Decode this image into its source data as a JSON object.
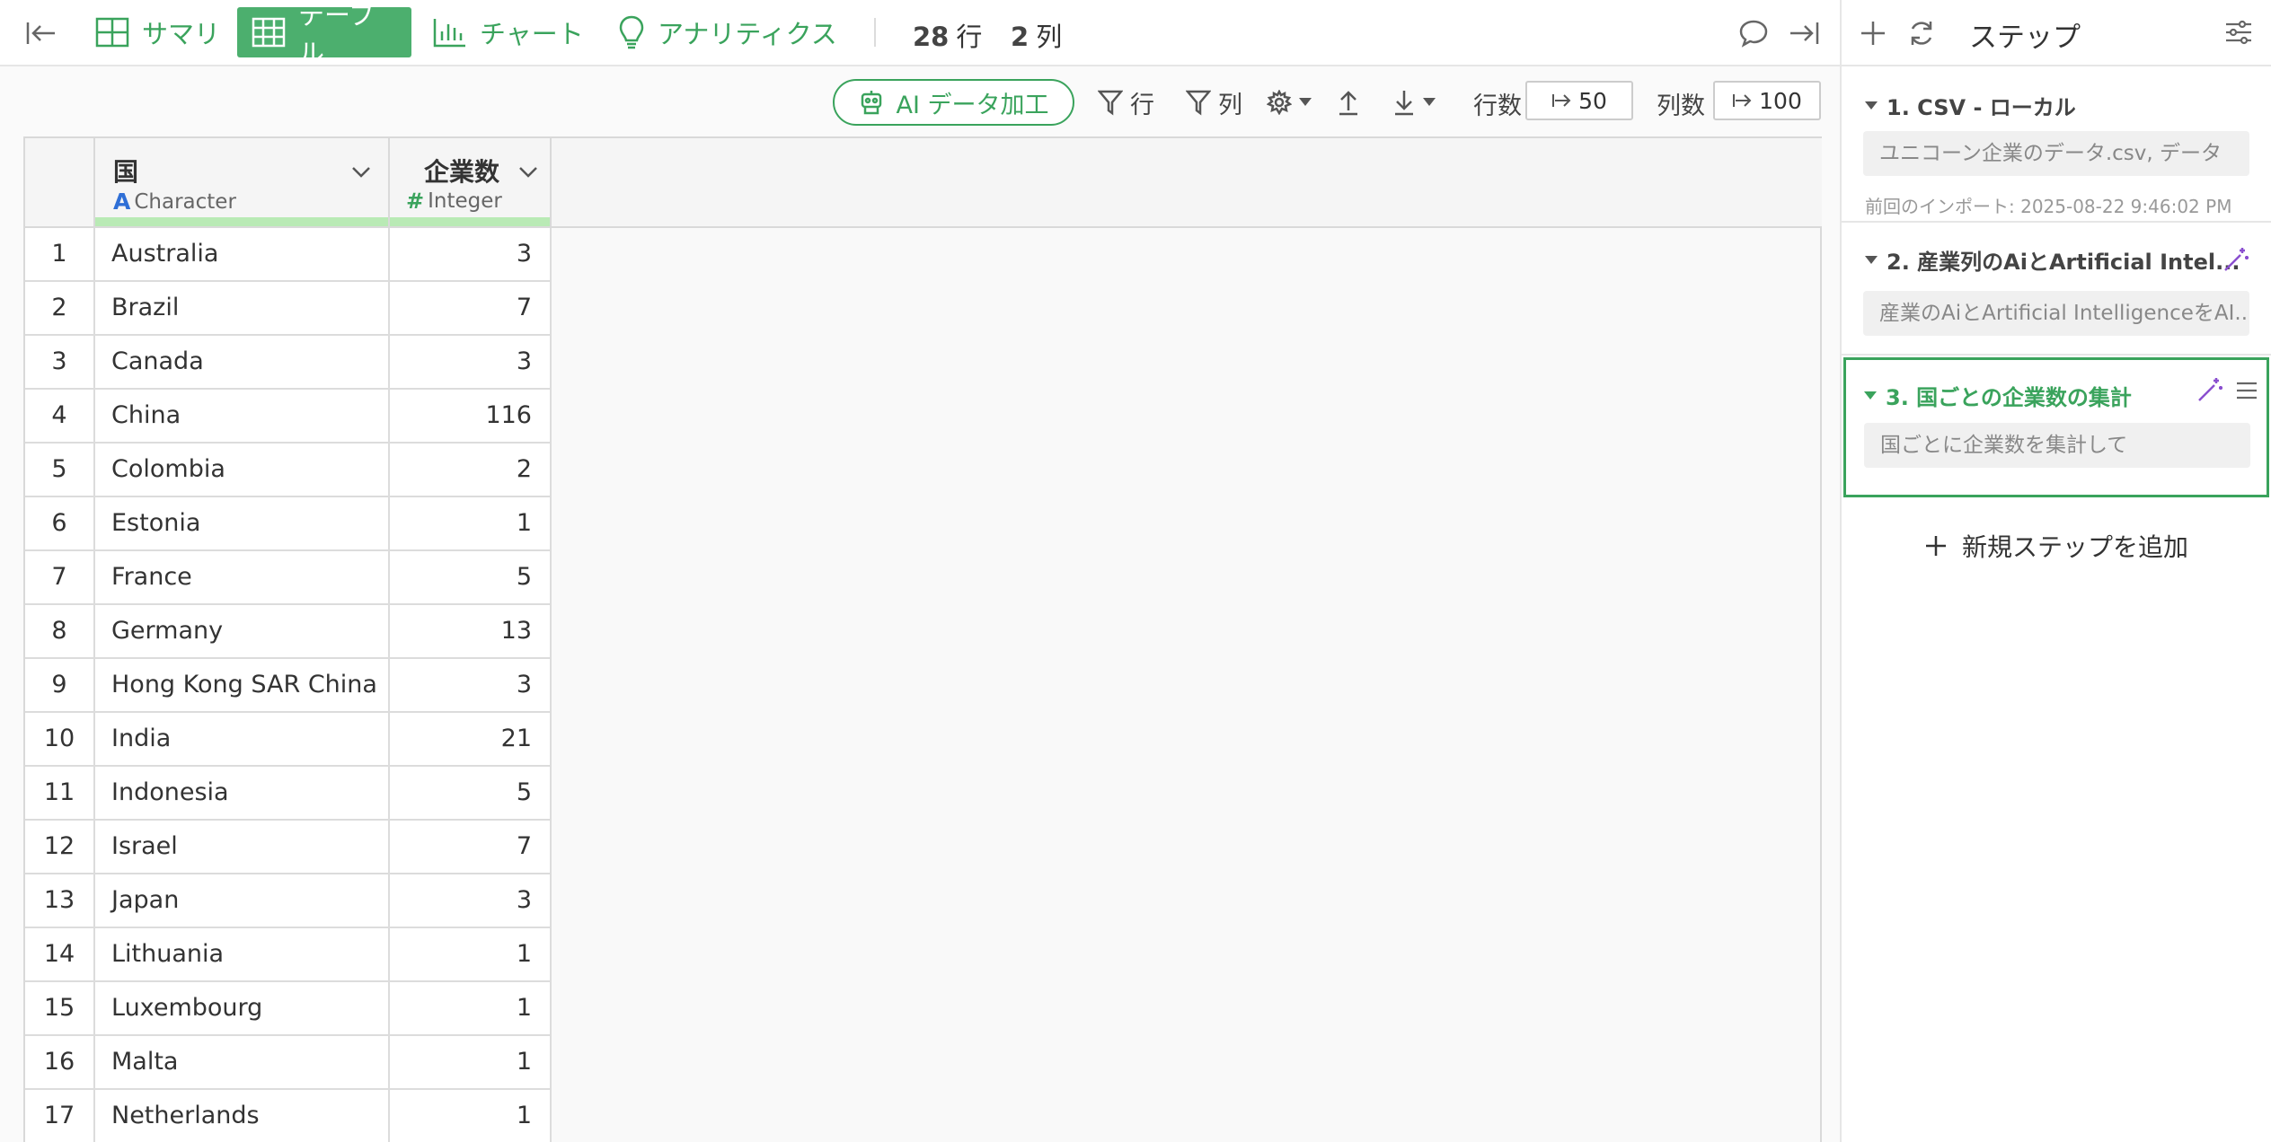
{
  "nav": {
    "tabs": [
      {
        "label": "サマリ",
        "icon": "summary-grid-icon"
      },
      {
        "label": "テーブル",
        "icon": "table-icon",
        "active": true
      },
      {
        "label": "チャート",
        "icon": "bar-chart-icon"
      },
      {
        "label": "アナリティクス",
        "icon": "lightbulb-icon"
      }
    ],
    "rows_count": "28",
    "rows_unit": "行",
    "cols_count": "2",
    "cols_unit": "列"
  },
  "toolbar": {
    "ai_label": "AI データ加工",
    "filter_rows_label": "行",
    "filter_cols_label": "列",
    "rows_label": "行数",
    "rows_value": "50",
    "cols_label": "列数",
    "cols_value": "100"
  },
  "table": {
    "columns": [
      {
        "name": "国",
        "type": "Character",
        "type_icon": "A"
      },
      {
        "name": "企業数",
        "type": "Integer",
        "type_icon": "#"
      }
    ],
    "rows": [
      {
        "idx": "1",
        "country": "Australia",
        "count": "3"
      },
      {
        "idx": "2",
        "country": "Brazil",
        "count": "7"
      },
      {
        "idx": "3",
        "country": "Canada",
        "count": "3"
      },
      {
        "idx": "4",
        "country": "China",
        "count": "116"
      },
      {
        "idx": "5",
        "country": "Colombia",
        "count": "2"
      },
      {
        "idx": "6",
        "country": "Estonia",
        "count": "1"
      },
      {
        "idx": "7",
        "country": "France",
        "count": "5"
      },
      {
        "idx": "8",
        "country": "Germany",
        "count": "13"
      },
      {
        "idx": "9",
        "country": "Hong Kong SAR China",
        "count": "3"
      },
      {
        "idx": "10",
        "country": "India",
        "count": "21"
      },
      {
        "idx": "11",
        "country": "Indonesia",
        "count": "5"
      },
      {
        "idx": "12",
        "country": "Israel",
        "count": "7"
      },
      {
        "idx": "13",
        "country": "Japan",
        "count": "3"
      },
      {
        "idx": "14",
        "country": "Lithuania",
        "count": "1"
      },
      {
        "idx": "15",
        "country": "Luxembourg",
        "count": "1"
      },
      {
        "idx": "16",
        "country": "Malta",
        "count": "1"
      },
      {
        "idx": "17",
        "country": "Netherlands",
        "count": "1"
      }
    ]
  },
  "panel": {
    "title": "ステップ",
    "steps": [
      {
        "title": "1. CSV - ローカル",
        "detail": "ユニコーン企業のデータ.csv, データ",
        "meta": "前回のインポート: 2025-08-22 9:46:02 PM"
      },
      {
        "title": "2. 産業列のAiとArtificial Intel...",
        "detail": "産業のAiとArtificial IntelligenceをAI..."
      },
      {
        "title": "3. 国ごとの企業数の集計",
        "detail": "国ごとに企業数を集計して"
      }
    ],
    "new_step_label": "新規ステップを追加"
  },
  "colors": {
    "accent": "#3aa35c",
    "active_tab": "#4caf6e",
    "wand": "#8a4fcf",
    "header_bar": "#b9eab5"
  }
}
